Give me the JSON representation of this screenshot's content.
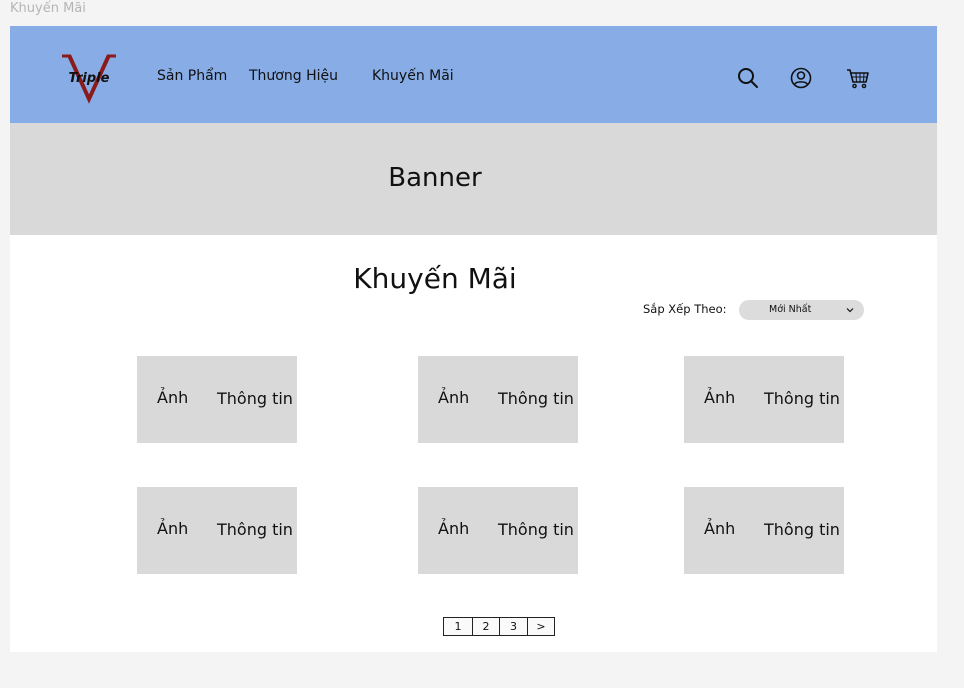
{
  "frame_title": "Khuyến Mãi",
  "header": {
    "logo_text": "Triple",
    "nav": [
      "Sản Phẩm",
      "Thương Hiệu",
      "Khuyến Mãi"
    ],
    "icons": [
      "search-icon",
      "user-icon",
      "cart-icon"
    ]
  },
  "banner": {
    "text": "Banner"
  },
  "main": {
    "title": "Khuyến Mãi",
    "sort": {
      "label": "Sắp Xếp Theo:",
      "value": "Mới Nhất"
    },
    "cards": [
      {
        "image": "Ảnh",
        "info": "Thông tin"
      },
      {
        "image": "Ảnh",
        "info": "Thông tin"
      },
      {
        "image": "Ảnh",
        "info": "Thông tin"
      },
      {
        "image": "Ảnh",
        "info": "Thông tin"
      },
      {
        "image": "Ảnh",
        "info": "Thông tin"
      },
      {
        "image": "Ảnh",
        "info": "Thông tin"
      }
    ],
    "pagination": [
      "1",
      "2",
      "3",
      ">"
    ]
  },
  "colors": {
    "header_bg": "#87ACE6",
    "placeholder_bg": "#D9D9D9",
    "logo_red": "#8B1A1A"
  }
}
